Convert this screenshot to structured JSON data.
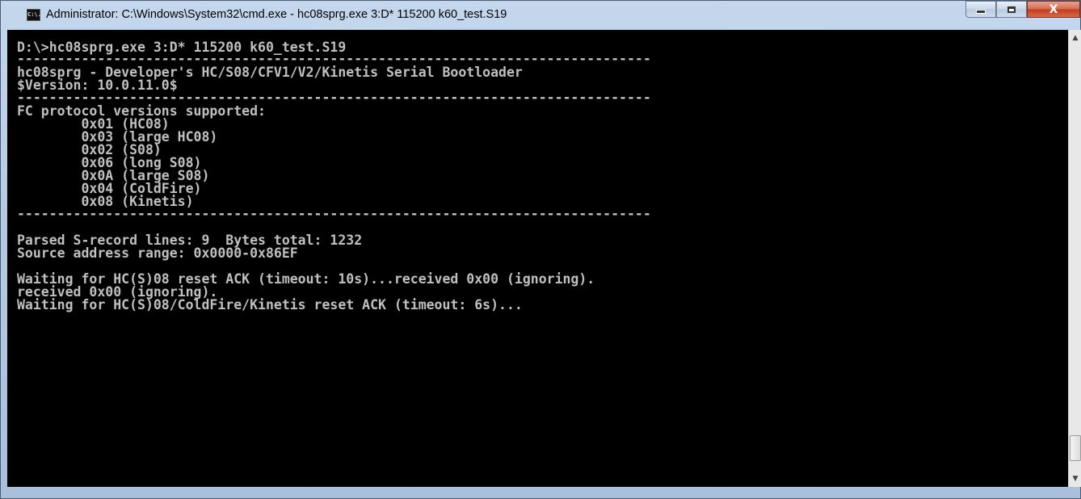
{
  "window": {
    "title": "Administrator: C:\\Windows\\System32\\cmd.exe - hc08sprg.exe  3:D* 115200 k60_test.S19",
    "icon": "console-icon",
    "icon_text": "C:\\."
  },
  "controls": {
    "minimize_icon": "minimize-icon",
    "maximize_icon": "maximize-icon",
    "close_icon": "close-icon",
    "close_glyph": "X"
  },
  "console": {
    "lines": [
      "D:\\>hc08sprg.exe 3:D* 115200 k60_test.S19",
      "-------------------------------------------------------------------------------",
      "hc08sprg - Developer's HC/S08/CFV1/V2/Kinetis Serial Bootloader",
      "$Version: 10.0.11.0$",
      "-------------------------------------------------------------------------------",
      "FC protocol versions supported:",
      "        0x01 (HC08)",
      "        0x03 (large HC08)",
      "        0x02 (S08)",
      "        0x06 (long S08)",
      "        0x0A (large S08)",
      "        0x04 (ColdFire)",
      "        0x08 (Kinetis)",
      "-------------------------------------------------------------------------------",
      "Parsed S-record lines: 9  Bytes total: 1232",
      "Source address range: 0x0000-0x86EF",
      "Waiting for HC(S)08 reset ACK (timeout: 10s)...received 0x00 (ignoring).",
      "received 0x00 (ignoring).",
      "Waiting for HC(S)08/ColdFire/Kinetis reset ACK (timeout: 6s)..."
    ]
  },
  "scrollbar": {
    "up_glyph": "▲",
    "down_glyph": "▼"
  },
  "colors": {
    "console_bg": "#000000",
    "console_text": "#c0c0c0",
    "close_button": "#c2391b"
  }
}
